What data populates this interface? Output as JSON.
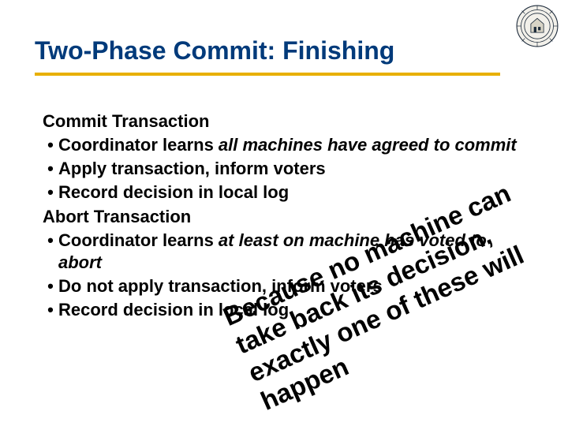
{
  "title": "Two-Phase Commit: Finishing",
  "seal": {
    "name": "institution-seal"
  },
  "sections": {
    "commit": {
      "heading": "Commit Transaction",
      "bullets": [
        {
          "pre": "Coordinator learns ",
          "em": "all machines have agreed to commit",
          "post": ""
        },
        {
          "pre": "Apply transaction, inform voters",
          "em": "",
          "post": ""
        },
        {
          "pre": "Record decision in local log",
          "em": "",
          "post": ""
        }
      ]
    },
    "abort": {
      "heading": "Abort Transaction",
      "bullets": [
        {
          "pre": "Coordinator learns ",
          "em": "at least on machine has voted to abort",
          "post": ""
        },
        {
          "pre": "Do not apply transaction, inform voters",
          "em": "",
          "post": ""
        },
        {
          "pre": "Record decision in local log",
          "em": "",
          "post": ""
        }
      ]
    }
  },
  "overlay_text": "Because no machine can take back its decision, exactly one of these will happen",
  "bullet_glyph": "•"
}
